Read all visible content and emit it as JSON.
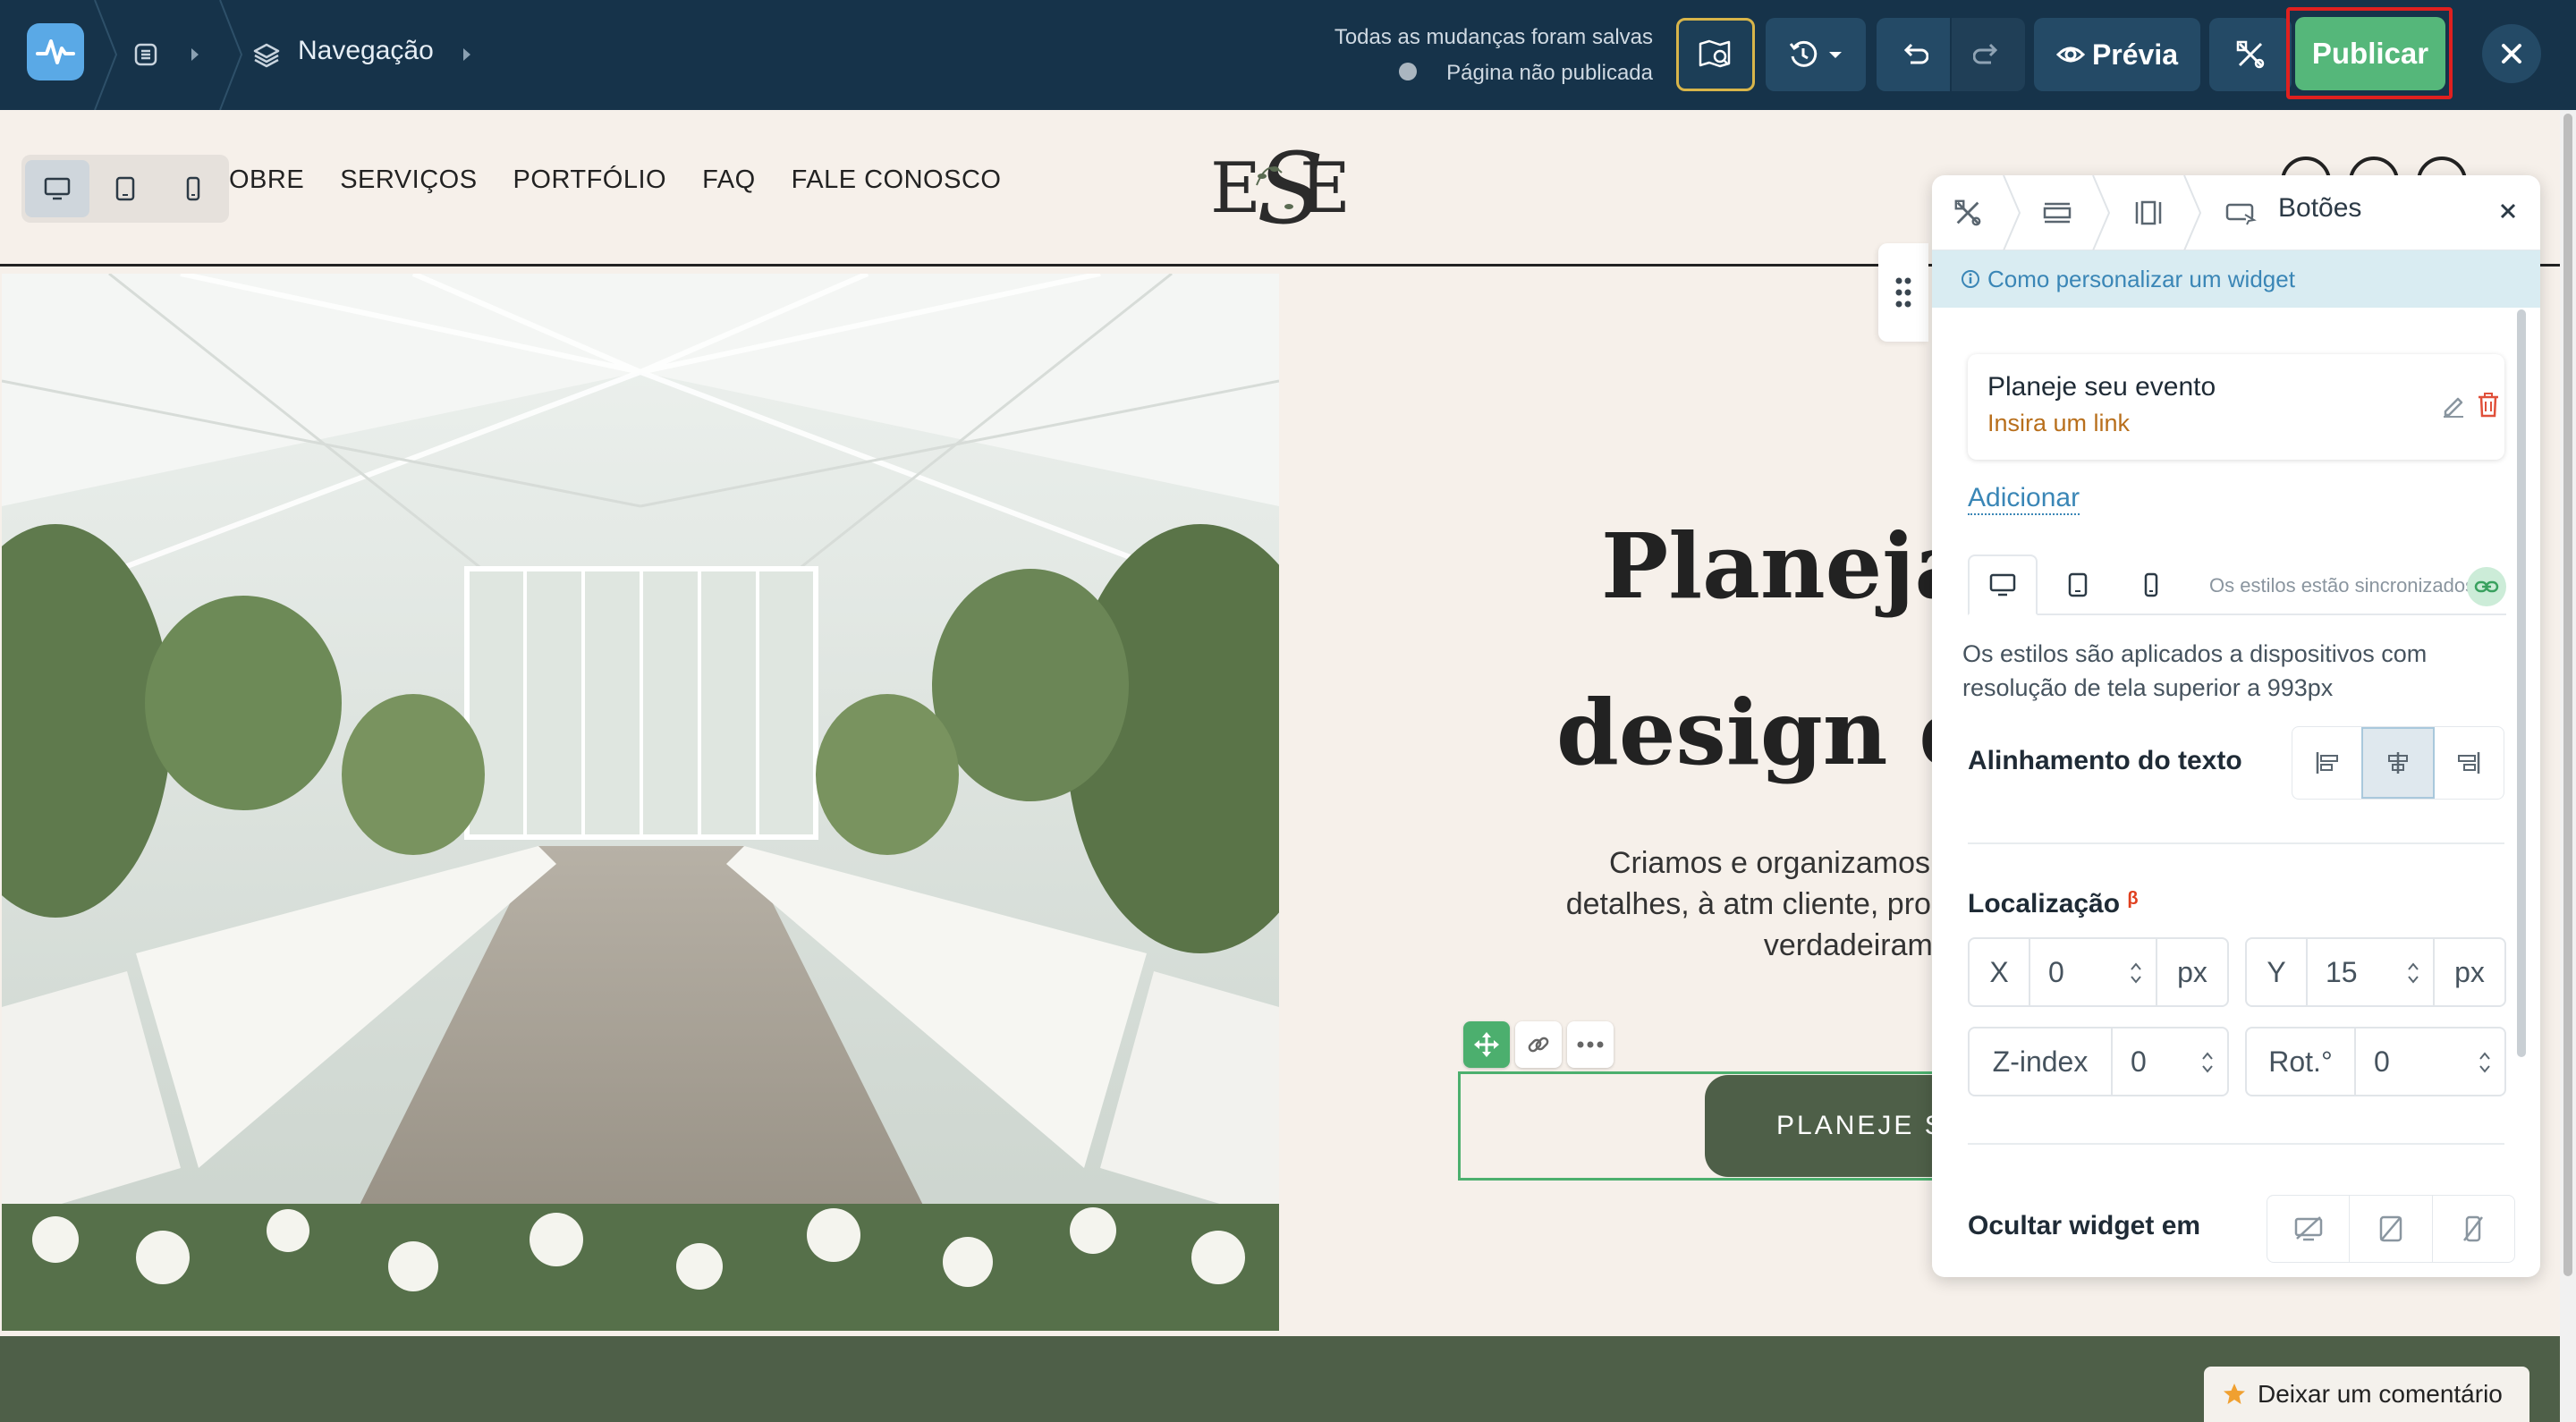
{
  "topbar": {
    "nav_label": "Navegação",
    "save_status": "Todas as mudanças foram salvas",
    "page_status": "Página não publicada",
    "preview_label": "Prévia",
    "publish_label": "Publicar"
  },
  "site": {
    "nav_items": [
      "OBRE",
      "SERVIÇOS",
      "PORTFÓLIO",
      "FAQ",
      "FALE CONOSCO"
    ],
    "hero_title_line1": "Planejam",
    "hero_title_line2": "design de",
    "hero_body": "Criamos e organizamos e atenção aos detalhes, à atm cliente, proporcionando expe verdadeirament",
    "cta_label": "PLANEJE SE",
    "comment_button": "Deixar um comentário"
  },
  "panel": {
    "title": "Botões",
    "help_link": "Como personalizar um widget",
    "button_item": {
      "label": "Planeje seu evento",
      "link_placeholder": "Insira um link"
    },
    "add_label": "Adicionar",
    "sync_label": "Os estilos estão sincronizados",
    "styles_desc": "Os estilos são aplicados a dispositivos com resolução de tela superior a 993px",
    "text_align_label": "Alinhamento do texto",
    "location_label": "Localização",
    "beta_mark": "β",
    "x": {
      "label": "X",
      "value": "0",
      "unit": "px"
    },
    "y": {
      "label": "Y",
      "value": "15",
      "unit": "px"
    },
    "z": {
      "label": "Z-index",
      "value": "0"
    },
    "rot": {
      "label": "Rot.°",
      "value": "0"
    },
    "hide_label": "Ocultar widget em"
  },
  "colors": {
    "topbar_bg": "#16334a",
    "publish_green": "#55b77a",
    "publish_highlight": "#e0201f",
    "accent_blue": "#3a86b6",
    "cta_green": "#4e5f48",
    "page_bg": "#f6f0ea"
  },
  "icons": {
    "logo": "pulse-icon",
    "map": "map-search-icon",
    "history": "history-icon",
    "undo": "undo-icon",
    "redo": "redo-icon",
    "preview": "eye-icon",
    "tools": "tools-icon",
    "close": "close-icon"
  }
}
